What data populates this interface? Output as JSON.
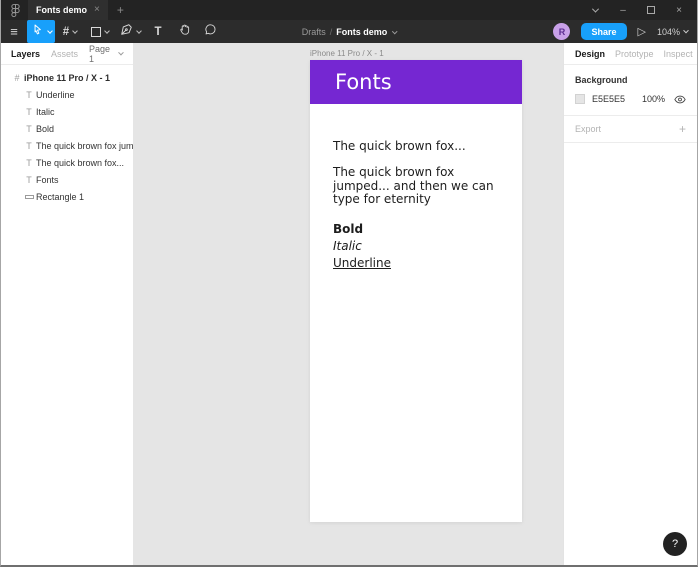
{
  "colors": {
    "titlebar_bg": "#232323",
    "toolbar_bg": "#2c2c2c",
    "accent_blue": "#18a0fb",
    "canvas_bg": "#e5e5e5",
    "frame_header_purple": "#7527d2",
    "avatar_bg": "#c9a1e9"
  },
  "icons": {
    "menu": "≡",
    "frame_tool": "#",
    "text_tool": "T",
    "present": "▷",
    "minimize": "–",
    "close": "×",
    "plus": "+",
    "help": "?"
  },
  "titlebar": {
    "tab": {
      "label": "Fonts demo",
      "close": "×"
    },
    "new_tab": "+"
  },
  "toolbar": {
    "breadcrumb": {
      "project": "Drafts",
      "separator": "/",
      "file": "Fonts demo"
    },
    "avatar_initial": "R",
    "share_label": "Share",
    "zoom_level": "104%"
  },
  "left_panel": {
    "tabs": {
      "layers": "Layers",
      "assets": "Assets"
    },
    "page_selector": "Page 1",
    "layers": [
      {
        "icon": "frame-icon",
        "label": "iPhone 11 Pro / X - 1"
      },
      {
        "icon": "text-icon",
        "label": "Underline"
      },
      {
        "icon": "text-icon",
        "label": "Italic"
      },
      {
        "icon": "text-icon",
        "label": "Bold"
      },
      {
        "icon": "text-icon",
        "label": "The quick brown fox jumped......"
      },
      {
        "icon": "text-icon",
        "label": "The quick brown fox..."
      },
      {
        "icon": "text-icon",
        "label": "Fonts"
      },
      {
        "icon": "rectangle-icon",
        "label": "Rectangle 1"
      }
    ]
  },
  "canvas": {
    "frame_label": "iPhone 11 Pro / X - 1",
    "frame": {
      "title": "Fonts",
      "line1": "The quick brown fox...",
      "paragraph": "The quick brown fox jumped... and then we can type for eternity",
      "bold_text": "Bold",
      "italic_text": "Italic",
      "underline_text": "Underline"
    },
    "help_label": "?"
  },
  "right_panel": {
    "tabs": [
      "Design",
      "Prototype",
      "Inspect"
    ],
    "background": {
      "label": "Background",
      "hex": "E5E5E5",
      "opacity": "100%"
    },
    "export": {
      "label": "Export",
      "add": "+"
    }
  }
}
